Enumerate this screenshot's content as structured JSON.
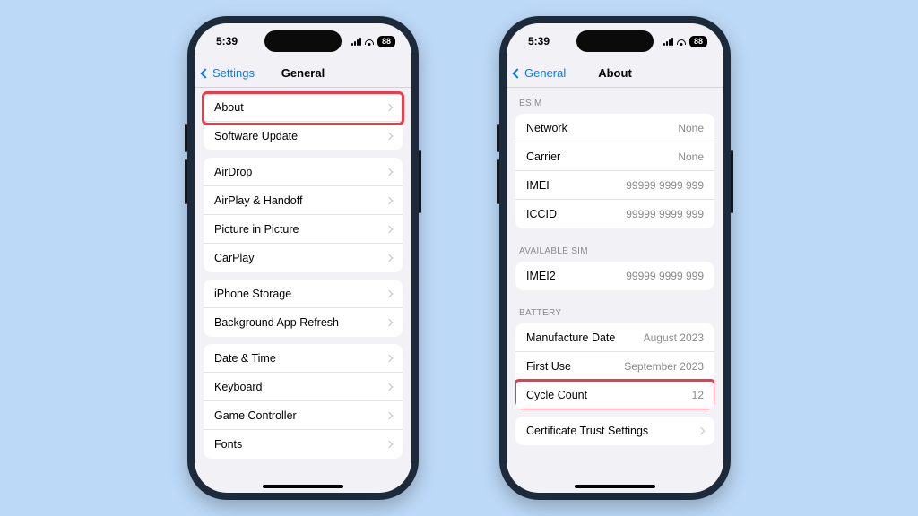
{
  "status": {
    "time": "5:39",
    "battery": "88"
  },
  "left": {
    "back": "Settings",
    "title": "General",
    "groups": [
      {
        "rows": [
          {
            "label": "About"
          },
          {
            "label": "Software Update"
          }
        ]
      },
      {
        "rows": [
          {
            "label": "AirDrop"
          },
          {
            "label": "AirPlay & Handoff"
          },
          {
            "label": "Picture in Picture"
          },
          {
            "label": "CarPlay"
          }
        ]
      },
      {
        "rows": [
          {
            "label": "iPhone Storage"
          },
          {
            "label": "Background App Refresh"
          }
        ]
      },
      {
        "rows": [
          {
            "label": "Date & Time"
          },
          {
            "label": "Keyboard"
          },
          {
            "label": "Game Controller"
          },
          {
            "label": "Fonts"
          }
        ]
      }
    ]
  },
  "right": {
    "back": "General",
    "title": "About",
    "sections": {
      "esim_header": "ESIM",
      "esim": [
        {
          "label": "Network",
          "value": "None"
        },
        {
          "label": "Carrier",
          "value": "None"
        },
        {
          "label": "IMEI",
          "value": "99999 9999 999"
        },
        {
          "label": "ICCID",
          "value": "99999 9999 999"
        }
      ],
      "avail_header": "AVAILABLE SIM",
      "avail": [
        {
          "label": "IMEI2",
          "value": "99999 9999 999"
        }
      ],
      "battery_header": "BATTERY",
      "battery": [
        {
          "label": "Manufacture Date",
          "value": "August 2023"
        },
        {
          "label": "First Use",
          "value": "September 2023"
        },
        {
          "label": "Cycle Count",
          "value": "12"
        }
      ],
      "cert": {
        "label": "Certificate Trust Settings"
      }
    }
  }
}
